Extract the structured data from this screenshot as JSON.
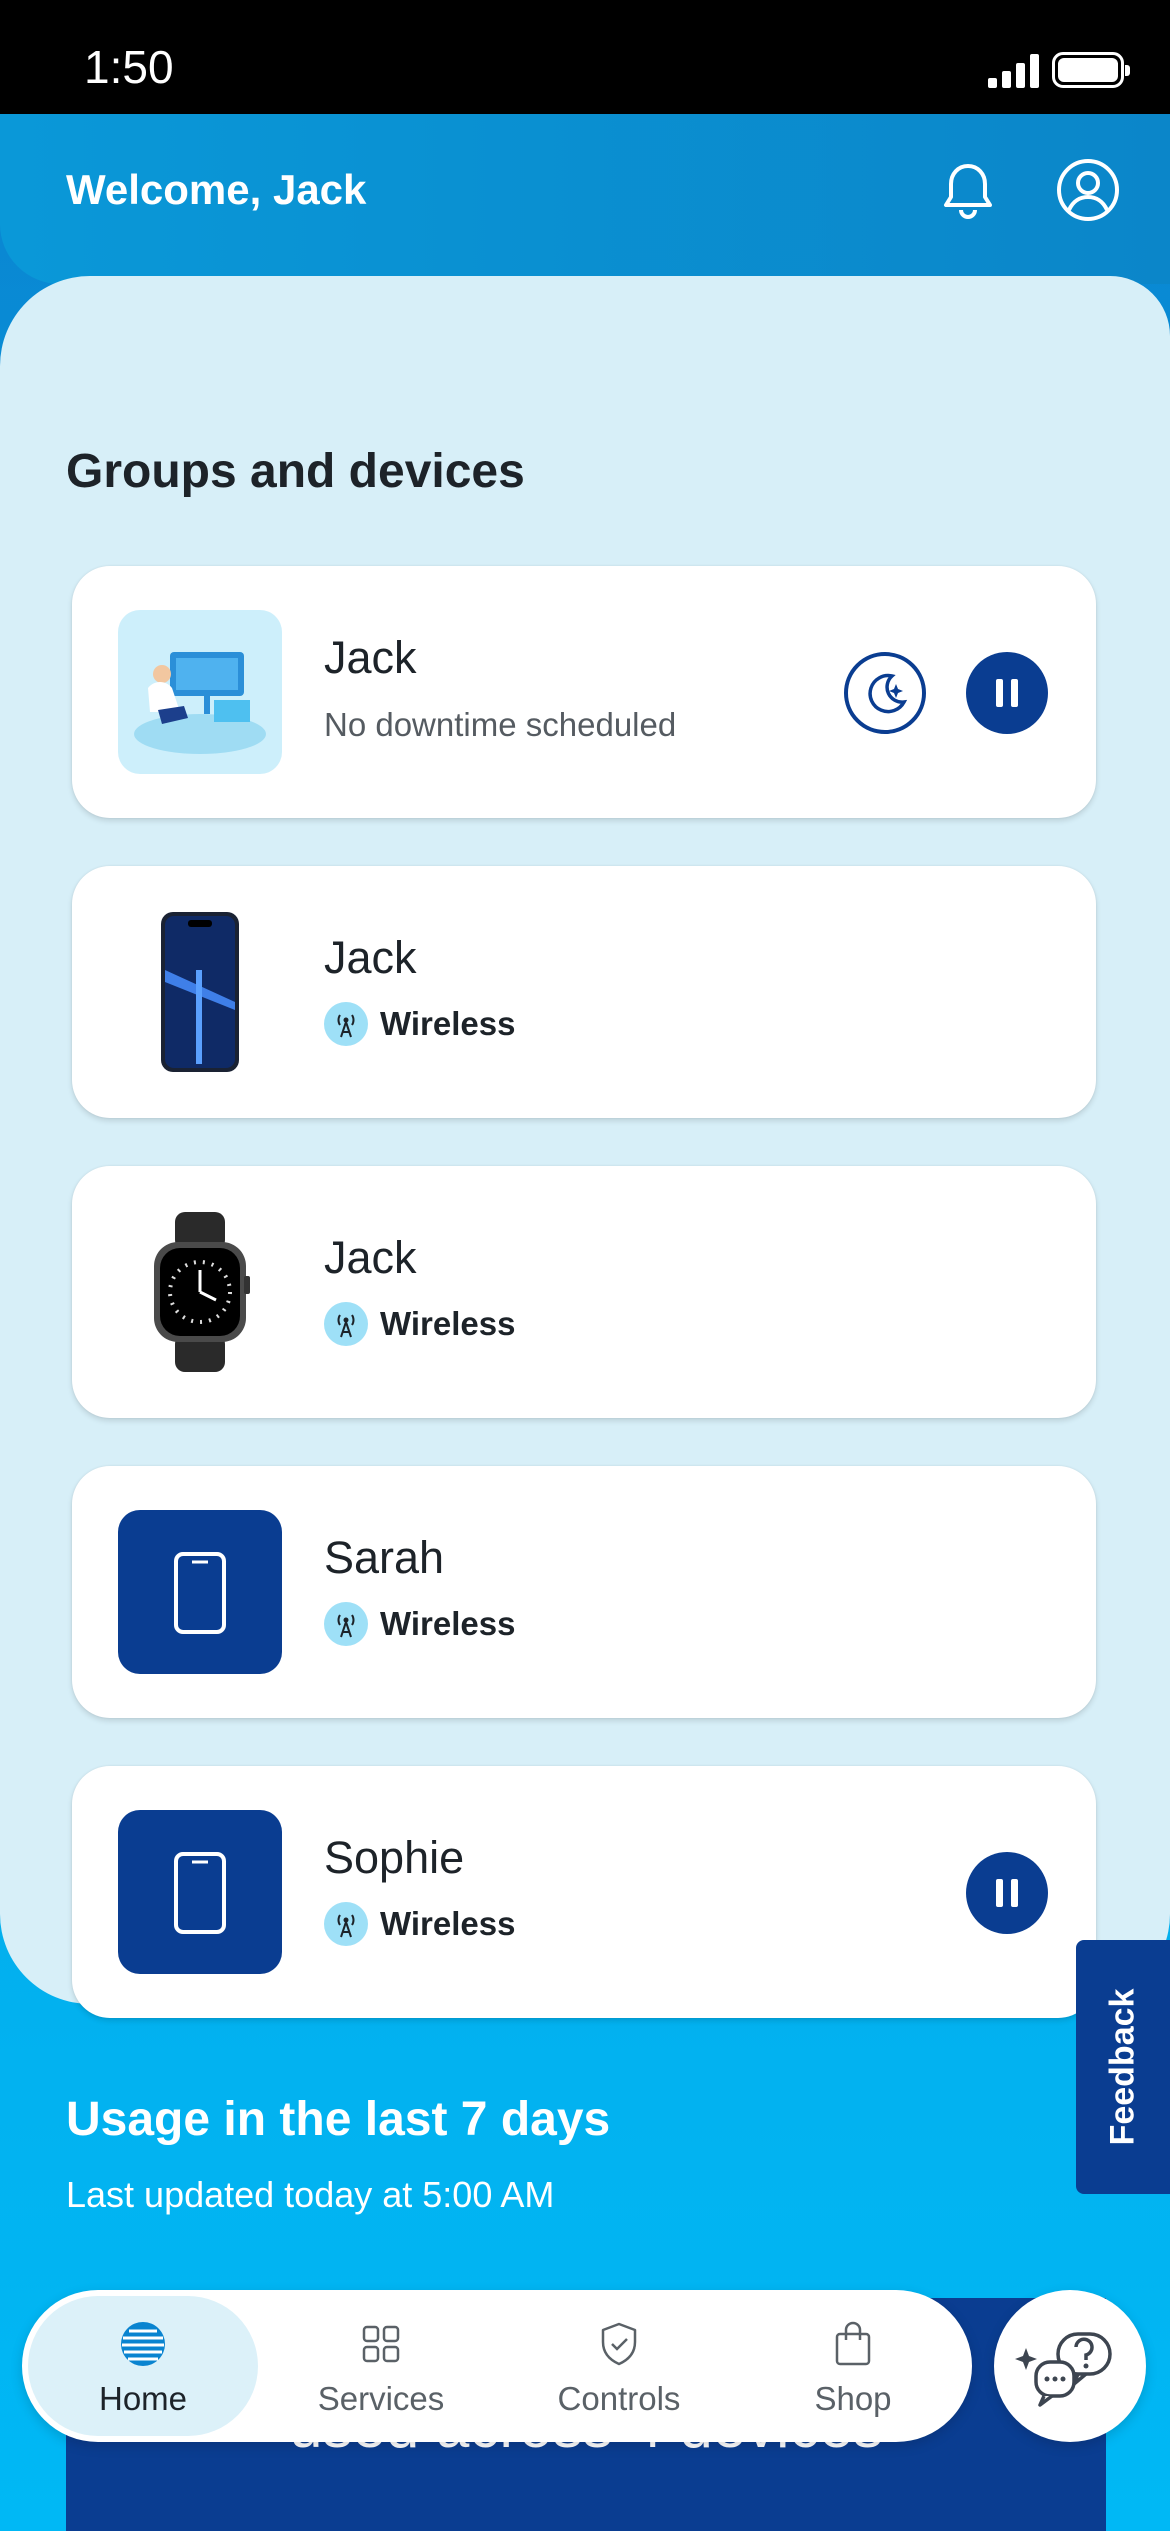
{
  "status_bar": {
    "time": "1:50"
  },
  "header": {
    "welcome": "Welcome, Jack"
  },
  "groups": {
    "title": "Groups and devices",
    "cards": [
      {
        "name": "Jack",
        "subtitle": "No downtime scheduled"
      },
      {
        "name": "Jack",
        "subtitle": "Wireless"
      },
      {
        "name": "Jack",
        "subtitle": "Wireless"
      },
      {
        "name": "Sarah",
        "subtitle": "Wireless"
      },
      {
        "name": "Sophie",
        "subtitle": "Wireless"
      }
    ]
  },
  "usage": {
    "title": "Usage in the last 7 days",
    "updated": "Last updated today at 5:00 AM",
    "card_text": "used across 4 devices"
  },
  "feedback": {
    "label": "Feedback"
  },
  "tabs": [
    {
      "label": "Home",
      "icon": "att-globe-icon",
      "active": true
    },
    {
      "label": "Services",
      "icon": "grid-icon",
      "active": false
    },
    {
      "label": "Controls",
      "icon": "shield-check-icon",
      "active": false
    },
    {
      "label": "Shop",
      "icon": "shopping-bag-icon",
      "active": false
    }
  ],
  "colors": {
    "brand_navy": "#0a3d91",
    "brand_blue": "#00a8e0",
    "panel_bg": "#d7eff8"
  }
}
